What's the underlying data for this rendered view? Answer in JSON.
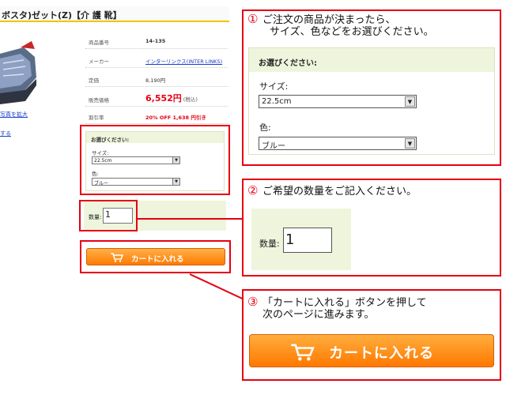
{
  "product": {
    "title": "ボスタ)ゼット(Z)【介 護 靴】",
    "zoom_link": "写真を拡大",
    "fav_link": "する"
  },
  "specs": {
    "item_no_label": "商品番号",
    "item_no_value": "14-135",
    "maker_label": "メーカー",
    "maker_value": "インターリンクス(INTER LINKS)",
    "list_price_label": "定価",
    "list_price_value": "8,190円",
    "sale_price_label": "販売価格",
    "sale_price_value": "6,552円",
    "sale_price_note": "(税込)",
    "discount_label": "割引率",
    "discount_value": "20% OFF 1,638 円引き"
  },
  "options": {
    "header": "お選びください:",
    "size_label": "サイズ:",
    "size_value": "22.5cm",
    "color_label": "色:",
    "color_value": "ブルー"
  },
  "quantity": {
    "label": "数量:",
    "value": "1"
  },
  "cart": {
    "button_label": "カートに入れる"
  },
  "steps": {
    "step1_num": "①",
    "step1_line1": "ご注文の商品が決まったら、",
    "step1_line2": "サイズ、色などをお選びください。",
    "step2_num": "②",
    "step2_text": "ご希望の数量をご記入ください。",
    "step3_num": "③",
    "step3_line1": "「カートに入れる」ボタンを押して",
    "step3_line2": "次のページに進みます。"
  },
  "colors": {
    "highlight_red": "#e60012",
    "panel_green": "#eef5dc",
    "cart_orange": "#ff7a00"
  }
}
